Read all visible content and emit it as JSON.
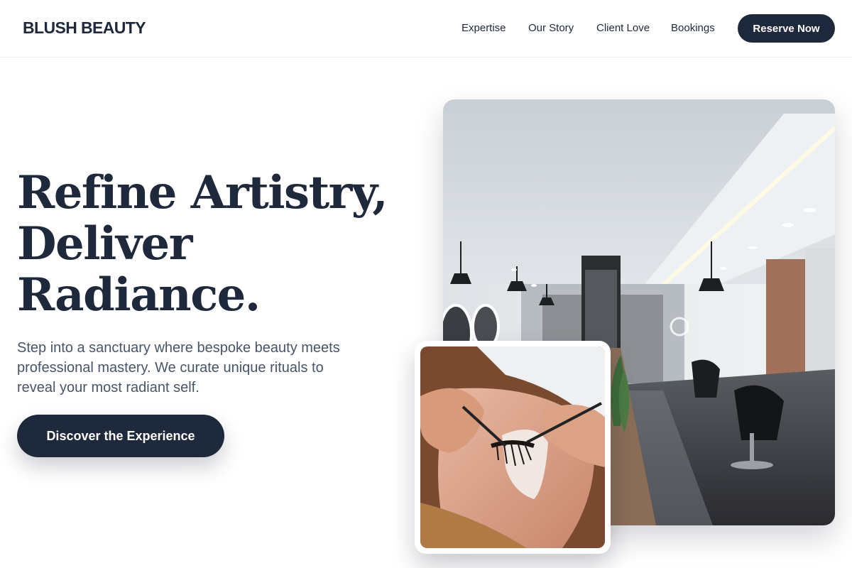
{
  "brand": {
    "name": "BLUSH BEAUTY"
  },
  "nav": {
    "items": [
      {
        "label": "Expertise"
      },
      {
        "label": "Our Story"
      },
      {
        "label": "Client Love"
      },
      {
        "label": "Bookings"
      }
    ],
    "cta_label": "Reserve Now"
  },
  "hero": {
    "headline_lines": [
      "Refine Artistry,",
      "Deliver",
      "Radiance."
    ],
    "subtext": "Step into a sanctuary where bespoke beauty meets professional mastery. We curate unique rituals to reveal your most radiant self.",
    "cta_label": "Discover the Experience"
  },
  "images": {
    "salon": {
      "icon": "salon-interior-photo"
    },
    "lash": {
      "icon": "lash-extension-photo"
    }
  },
  "colors": {
    "primary": "#1e293b",
    "body_text": "#475569",
    "background": "#ffffff"
  }
}
